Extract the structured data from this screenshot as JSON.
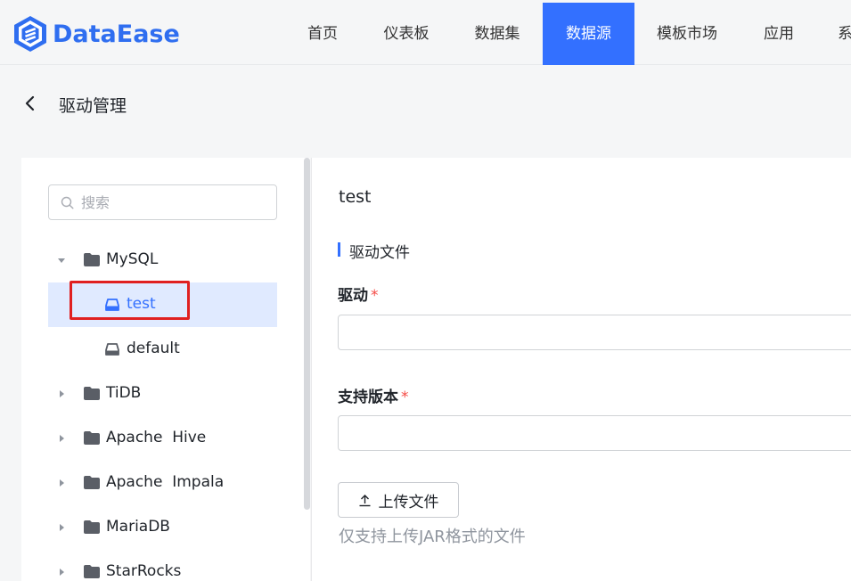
{
  "header": {
    "logo_text": "DataEase",
    "nav": [
      {
        "label": "首页",
        "active": false
      },
      {
        "label": "仪表板",
        "active": false
      },
      {
        "label": "数据集",
        "active": false
      },
      {
        "label": "数据源",
        "active": true
      },
      {
        "label": "模板市场",
        "active": false
      },
      {
        "label": "应用",
        "active": false
      },
      {
        "label": "系",
        "active": false
      }
    ],
    "active_color": "#3370ff"
  },
  "page": {
    "title": "驱动管理",
    "back_icon": "chevron-left-icon"
  },
  "sidebar": {
    "search_placeholder": "搜索",
    "tree": [
      {
        "label": "MySQL",
        "type": "folder",
        "expanded": true
      },
      {
        "label": "test",
        "type": "driver",
        "selected": true
      },
      {
        "label": "default",
        "type": "driver",
        "selected": false
      },
      {
        "label": "TiDB",
        "type": "folder",
        "expanded": false
      },
      {
        "label": "Apache  Hive",
        "type": "folder",
        "expanded": false
      },
      {
        "label": "Apache  Impala",
        "type": "folder",
        "expanded": false
      },
      {
        "label": "MariaDB",
        "type": "folder",
        "expanded": false
      },
      {
        "label": "StarRocks",
        "type": "folder",
        "expanded": false
      }
    ]
  },
  "detail": {
    "title": "test",
    "section_title": "驱动文件",
    "driver_label": "驱动",
    "driver_value": "",
    "version_label": "支持版本",
    "version_value": "",
    "required_mark": "*",
    "upload_label": "上传文件",
    "upload_tip": "仅支持上传JAR格式的文件"
  }
}
